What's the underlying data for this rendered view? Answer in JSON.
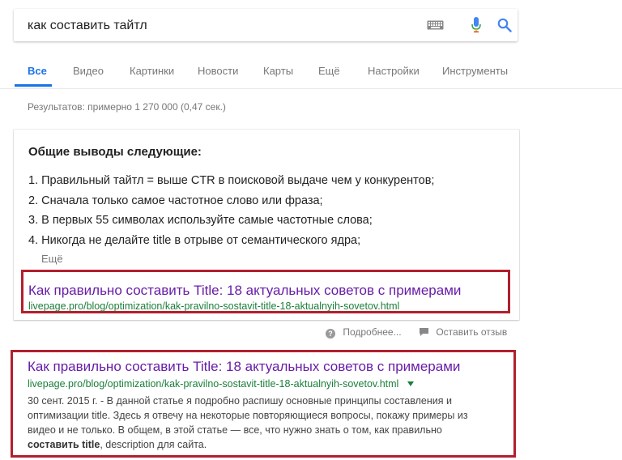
{
  "search": {
    "query": "как составить тайтл",
    "icons": [
      "keyboard-icon",
      "microphone-icon",
      "search-icon"
    ]
  },
  "tabs": [
    {
      "label": "Все",
      "active": true
    },
    {
      "label": "Видео",
      "active": false
    },
    {
      "label": "Картинки",
      "active": false
    },
    {
      "label": "Новости",
      "active": false
    },
    {
      "label": "Карты",
      "active": false
    },
    {
      "label": "Ещё",
      "active": false
    },
    {
      "label": "Настройки",
      "active": false
    },
    {
      "label": "Инструменты",
      "active": false
    }
  ],
  "result_stats": "Результатов: примерно 1 270 000 (0,47 сек.)",
  "featured_snippet": {
    "heading": "Общие выводы следующие:",
    "items": [
      "1. Правильный тайтл = выше CTR в поисковой выдаче чем у конкурентов;",
      "2. Сначала только самое частотное слово или фраза;",
      "3. В первых 55 символах используйте самые частотные слова;",
      "4. Никогда не делайте title в отрыве от семантического ядра;"
    ],
    "more_label": "Ещё",
    "result": {
      "title": "Как правильно составить Title: 18 актуальных советов с примерами",
      "url": "livepage.pro/blog/optimization/kak-pravilno-sostavit-title-18-aktualnyih-sovetov.html"
    }
  },
  "feedback": {
    "more_info": "Подробнее...",
    "leave_feedback": "Оставить отзыв"
  },
  "organic_result": {
    "title": "Как правильно составить Title: 18 актуальных советов с примерами",
    "url": "livepage.pro/blog/optimization/kak-pravilno-sostavit-title-18-aktualnyih-sovetov.html",
    "description_lines": [
      "30 сент. 2015 г. - В данной статье я подробно распишу основные принципы составления и",
      "оптимизации title. Здесь я отвечу на некоторые повторяющиеся вопросы, покажу примеры из",
      "видео и не только. В общем, в этой статье — все, что нужно знать о том, как правильно"
    ],
    "last_line_bold": "составить title",
    "last_line_rest": ", description для сайта."
  },
  "colors": {
    "accent": "#1a73e8",
    "link_visited": "#681da8",
    "url_green": "#1a7f3a",
    "highlight_border": "#b21f2d"
  }
}
